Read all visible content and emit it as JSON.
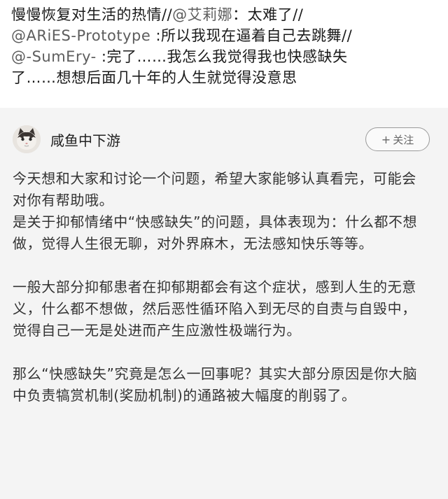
{
  "repost": {
    "line1_text": "慢慢恢复对生活的热情//",
    "line1_handle": "@艾莉娜",
    "line1_rest": "：太难了//",
    "line2_handle": "@ARiES-Prototype",
    "line2_rest": " :所以我现在逼着自己去跳舞//",
    "line3_handle": "@-SumEry-",
    "line3_rest": " :完了……我怎么我觉得我也快感缺失",
    "line4_text": "了……想想后面几十年的人生就觉得没意思"
  },
  "post": {
    "username": "咸鱼中下游",
    "follow_label": "关注",
    "follow_plus": "+",
    "paragraphs": [
      "今天想和大家和讨论一个问题，希望大家能够认真看完，可能会对你有帮助哦。",
      "是关于抑郁情绪中“快感缺失”的问题，具体表现为：什么都不想做，觉得人生很无聊，对外界麻木，无法感知快乐等等。",
      "一般大部分抑郁患者在抑郁期都会有这个症状，感到人生的无意义，什么都不想做，然后恶性循环陷入到无尽的自责与自毁中，觉得自己一无是处进而产生应激性极端行为。",
      "那么“快感缺失”究竟是怎么一回事呢？其实大部分原因是你大脑中负责犒赏机制(奖励机制)的通路被大幅度的削弱了。"
    ]
  }
}
